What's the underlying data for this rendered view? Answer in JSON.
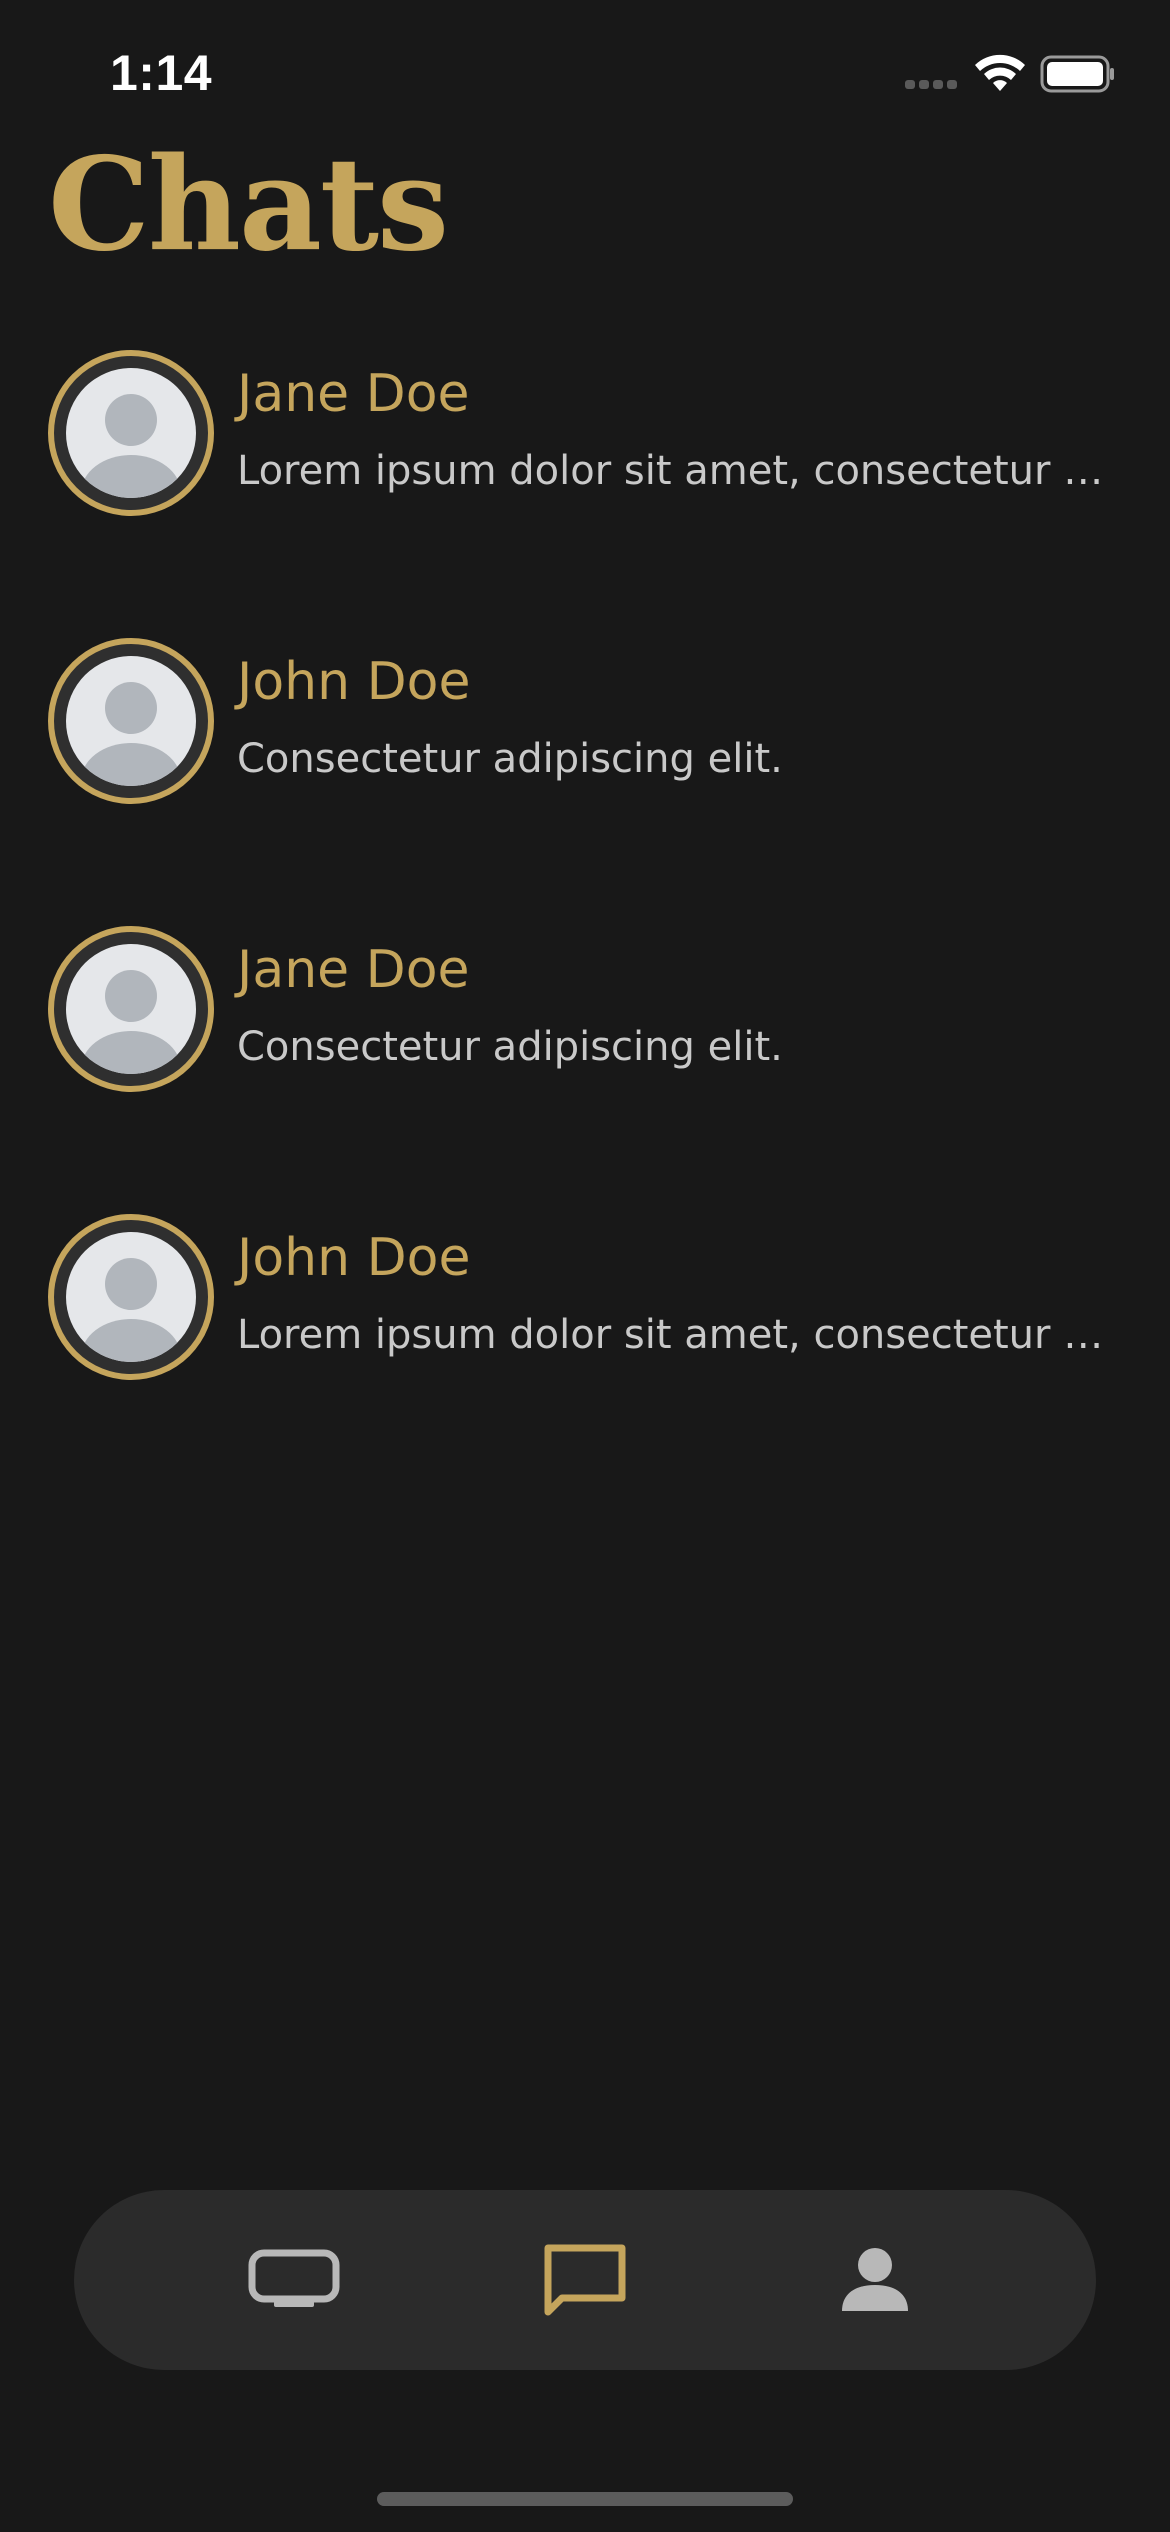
{
  "status_bar": {
    "time": "1:14",
    "signal_icon": "cellular-signal-icon",
    "wifi_icon": "wifi-icon",
    "battery_icon": "battery-icon"
  },
  "header": {
    "title": "Chats"
  },
  "chats": [
    {
      "name": "Jane Doe",
      "preview": "Lorem ipsum dolor sit amet, consectetur adipiscing elit.",
      "avatar_icon": "person-placeholder-icon"
    },
    {
      "name": "John Doe",
      "preview": "Consectetur adipiscing elit.",
      "avatar_icon": "person-placeholder-icon"
    },
    {
      "name": "Jane Doe",
      "preview": "Consectetur adipiscing elit.",
      "avatar_icon": "person-placeholder-icon"
    },
    {
      "name": "John Doe",
      "preview": "Lorem ipsum dolor sit amet, consectetur adipiscing elit.",
      "avatar_icon": "person-placeholder-icon"
    }
  ],
  "tab_bar": {
    "tabs": [
      {
        "icon": "tv-icon",
        "active": false
      },
      {
        "icon": "chat-bubble-icon",
        "active": true
      },
      {
        "icon": "person-icon",
        "active": false
      }
    ]
  },
  "colors": {
    "background": "#181818",
    "accent": "#c5a55c",
    "tab_bar_bg": "#2b2b2b",
    "preview_text": "#c9c9c9",
    "inactive_icon": "#b8b8b8"
  }
}
